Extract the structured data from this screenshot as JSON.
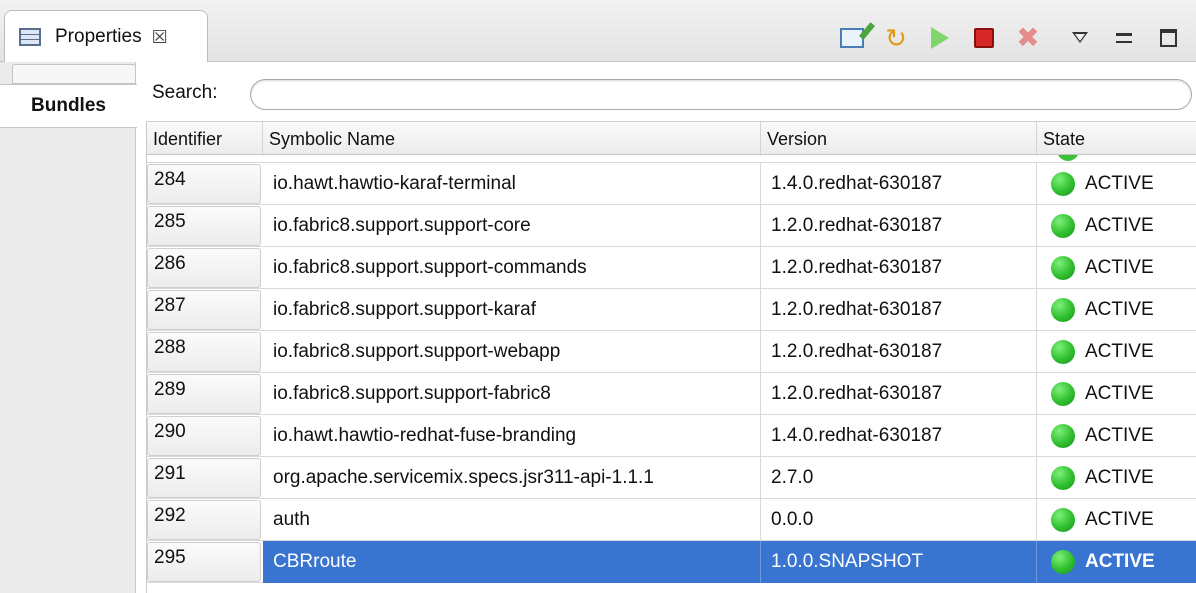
{
  "view_tab": {
    "label": "Properties",
    "close": "☒"
  },
  "toolbar": {
    "refresh_glyph": "↻",
    "delete_glyph": "✖"
  },
  "sidebar": {
    "tab_label": "Bundles"
  },
  "search": {
    "label": "Search:",
    "value": "",
    "placeholder": ""
  },
  "table": {
    "columns": [
      "Identifier",
      "Symbolic Name",
      "Version",
      "State"
    ],
    "rows": [
      {
        "id": "284",
        "name": "io.hawt.hawtio-karaf-terminal",
        "version": "1.4.0.redhat-630187",
        "state": "ACTIVE"
      },
      {
        "id": "285",
        "name": "io.fabric8.support.support-core",
        "version": "1.2.0.redhat-630187",
        "state": "ACTIVE"
      },
      {
        "id": "286",
        "name": "io.fabric8.support.support-commands",
        "version": "1.2.0.redhat-630187",
        "state": "ACTIVE"
      },
      {
        "id": "287",
        "name": "io.fabric8.support.support-karaf",
        "version": "1.2.0.redhat-630187",
        "state": "ACTIVE"
      },
      {
        "id": "288",
        "name": "io.fabric8.support.support-webapp",
        "version": "1.2.0.redhat-630187",
        "state": "ACTIVE"
      },
      {
        "id": "289",
        "name": "io.fabric8.support.support-fabric8",
        "version": "1.2.0.redhat-630187",
        "state": "ACTIVE"
      },
      {
        "id": "290",
        "name": "io.hawt.hawtio-redhat-fuse-branding",
        "version": "1.4.0.redhat-630187",
        "state": "ACTIVE"
      },
      {
        "id": "291",
        "name": "org.apache.servicemix.specs.jsr311-api-1.1.1",
        "version": "2.7.0",
        "state": "ACTIVE"
      },
      {
        "id": "292",
        "name": "auth",
        "version": "0.0.0",
        "state": "ACTIVE"
      },
      {
        "id": "295",
        "name": "CBRroute",
        "version": "1.0.0.SNAPSHOT",
        "state": "ACTIVE",
        "selected": true
      }
    ]
  },
  "colors": {
    "active_dot": "#2fbf2f",
    "selection": "#3874d0"
  }
}
